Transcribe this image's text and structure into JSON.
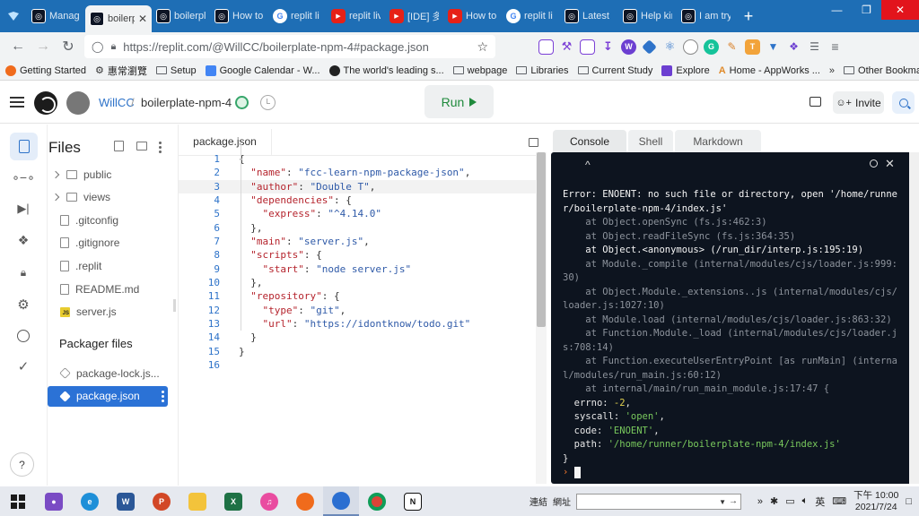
{
  "browser": {
    "tabs": [
      {
        "label": "Manag",
        "icon": "replit",
        "active": false
      },
      {
        "label": "boilerp",
        "icon": "replit",
        "active": true
      },
      {
        "label": "boilerpl",
        "icon": "replit",
        "active": false
      },
      {
        "label": "How to",
        "icon": "replit",
        "active": false
      },
      {
        "label": "replit li",
        "icon": "google",
        "active": false
      },
      {
        "label": "replit liv",
        "icon": "youtube",
        "active": false
      },
      {
        "label": "[IDE] 多",
        "icon": "youtube",
        "active": false
      },
      {
        "label": "How to",
        "icon": "youtube",
        "active": false
      },
      {
        "label": "replit li",
        "icon": "google",
        "active": false
      },
      {
        "label": "Latest",
        "icon": "replit",
        "active": false
      },
      {
        "label": "Help kin",
        "icon": "replit",
        "active": false
      },
      {
        "label": "I am try",
        "icon": "replit",
        "active": false
      }
    ],
    "url": "https://replit.com/@WillCC/boilerplate-npm-4#package.json",
    "bookmarks": [
      "Getting Started",
      "惠常瀏覽",
      "Setup",
      "Google Calendar - W...",
      "The world's leading s...",
      "webpage",
      "Libraries",
      "Current Study",
      "Explore",
      "Home - AppWorks ..."
    ],
    "other_bookmarks": "Other Bookmarks"
  },
  "replit": {
    "user": "WillCC",
    "repl_name": "boilerplate-npm-4",
    "run_label": "Run",
    "invite_label": "Invite"
  },
  "files": {
    "title": "Files",
    "items": [
      {
        "name": "public",
        "type": "folder"
      },
      {
        "name": "views",
        "type": "folder"
      },
      {
        "name": ".gitconfig",
        "type": "file"
      },
      {
        "name": ".gitignore",
        "type": "file"
      },
      {
        "name": ".replit",
        "type": "file"
      },
      {
        "name": "README.md",
        "type": "file"
      },
      {
        "name": "server.js",
        "type": "js"
      }
    ],
    "packager_title": "Packager files",
    "packager_items": [
      {
        "name": "package-lock.js...",
        "selected": false
      },
      {
        "name": "package.json",
        "selected": true
      }
    ]
  },
  "editor": {
    "tab": "package.json",
    "current_line": 3,
    "line_numbers": [
      "1",
      "2",
      "3",
      "4",
      "5",
      "6",
      "7",
      "8",
      "9",
      "10",
      "11",
      "12",
      "13",
      "14",
      "15",
      "16"
    ],
    "code": [
      "{",
      "  \"name\": \"fcc-learn-npm-package-json\",",
      "  \"author\": \"Double T\",",
      "  \"dependencies\": {",
      "    \"express\": \"^4.14.0\"",
      "  },",
      "  \"main\": \"server.js\",",
      "  \"scripts\": {",
      "    \"start\": \"node server.js\"",
      "  },",
      "  \"repository\": {",
      "    \"type\": \"git\",",
      "    \"url\": \"https://idontknow/todo.git\"",
      "  }",
      "}",
      ""
    ]
  },
  "console": {
    "tabs": [
      "Console",
      "Shell",
      "Markdown"
    ],
    "caret": "^",
    "lines": [
      {
        "text": "Error: ENOENT: no such file or directory, open '/home/runne",
        "style": "bright"
      },
      {
        "text": "r/boilerplate-npm-4/index.js'",
        "style": "bright"
      },
      {
        "text": "    at Object.openSync (fs.js:462:3)",
        "style": "dim"
      },
      {
        "text": "    at Object.readFileSync (fs.js:364:35)",
        "style": "dim"
      },
      {
        "text": "    at Object.<anonymous> (/run_dir/interp.js:195:19)",
        "style": "bright"
      },
      {
        "text": "    at Module._compile (internal/modules/cjs/loader.js:999:",
        "style": "dim"
      },
      {
        "text": "30)",
        "style": "dim"
      },
      {
        "text": "    at Object.Module._extensions..js (internal/modules/cjs/",
        "style": "dim"
      },
      {
        "text": "loader.js:1027:10)",
        "style": "dim"
      },
      {
        "text": "    at Module.load (internal/modules/cjs/loader.js:863:32)",
        "style": "dim"
      },
      {
        "text": "    at Function.Module._load (internal/modules/cjs/loader.j",
        "style": "dim"
      },
      {
        "text": "s:708:14)",
        "style": "dim"
      },
      {
        "text": "    at Function.executeUserEntryPoint [as runMain] (interna",
        "style": "dim"
      },
      {
        "text": "l/modules/run_main.js:60:12)",
        "style": "dim"
      },
      {
        "text": "    at internal/main/run_main_module.js:17:47 {",
        "style": "dim"
      }
    ],
    "props": [
      {
        "key": "errno",
        "value": "-2",
        "kind": "num"
      },
      {
        "key": "syscall",
        "value": "'open'",
        "kind": "str"
      },
      {
        "key": "code",
        "value": "'ENOENT'",
        "kind": "str"
      },
      {
        "key": "path",
        "value": "'/home/runner/boilerplate-npm-4/index.js'",
        "kind": "str"
      }
    ],
    "closing": "}",
    "prompt": "›"
  },
  "taskbar": {
    "apps": [
      "github-desktop",
      "edge",
      "word",
      "powerpoint",
      "file-explorer",
      "excel",
      "itunes",
      "firefox",
      "firefox-dev",
      "chrome",
      "notion"
    ],
    "address_label_1": "連結",
    "address_label_2": "網址",
    "ime": "英",
    "time": "下午 10:00",
    "date": "2021/7/24"
  },
  "colors": {
    "tab_strip": "#1e6eb5",
    "run_green": "#1f8a3c",
    "link_blue": "#2e73c9",
    "terminal_bg": "#0d141f",
    "json_key": "#b5242d",
    "json_string": "#2f5aa8"
  }
}
